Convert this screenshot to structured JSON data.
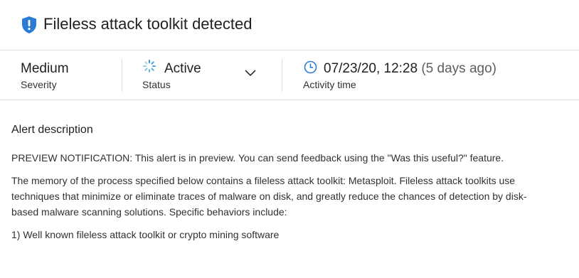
{
  "header": {
    "icon": "shield-alert-icon",
    "title": "Fileless attack toolkit detected",
    "accent": "#0078d4"
  },
  "meta": {
    "severity": {
      "value": "Medium",
      "label": "Severity"
    },
    "status": {
      "icon": "spinner-icon",
      "value": "Active",
      "label": "Status"
    },
    "activity": {
      "icon": "clock-icon",
      "time": "07/23/20, 12:28",
      "relative": "(5 days ago)",
      "label": "Activity time"
    }
  },
  "description": {
    "heading": "Alert description",
    "paragraphs": [
      "PREVIEW NOTIFICATION: This alert is in preview. You can send feedback using the \"Was this useful?\" feature.",
      "The memory of the process specified below contains a fileless attack toolkit: Metasploit. Fileless attack toolkits use techniques that minimize or eliminate traces of malware on disk, and greatly reduce the chances of detection by disk-based malware scanning solutions. Specific behaviors include:",
      "1) Well known fileless attack toolkit or crypto mining software"
    ]
  }
}
